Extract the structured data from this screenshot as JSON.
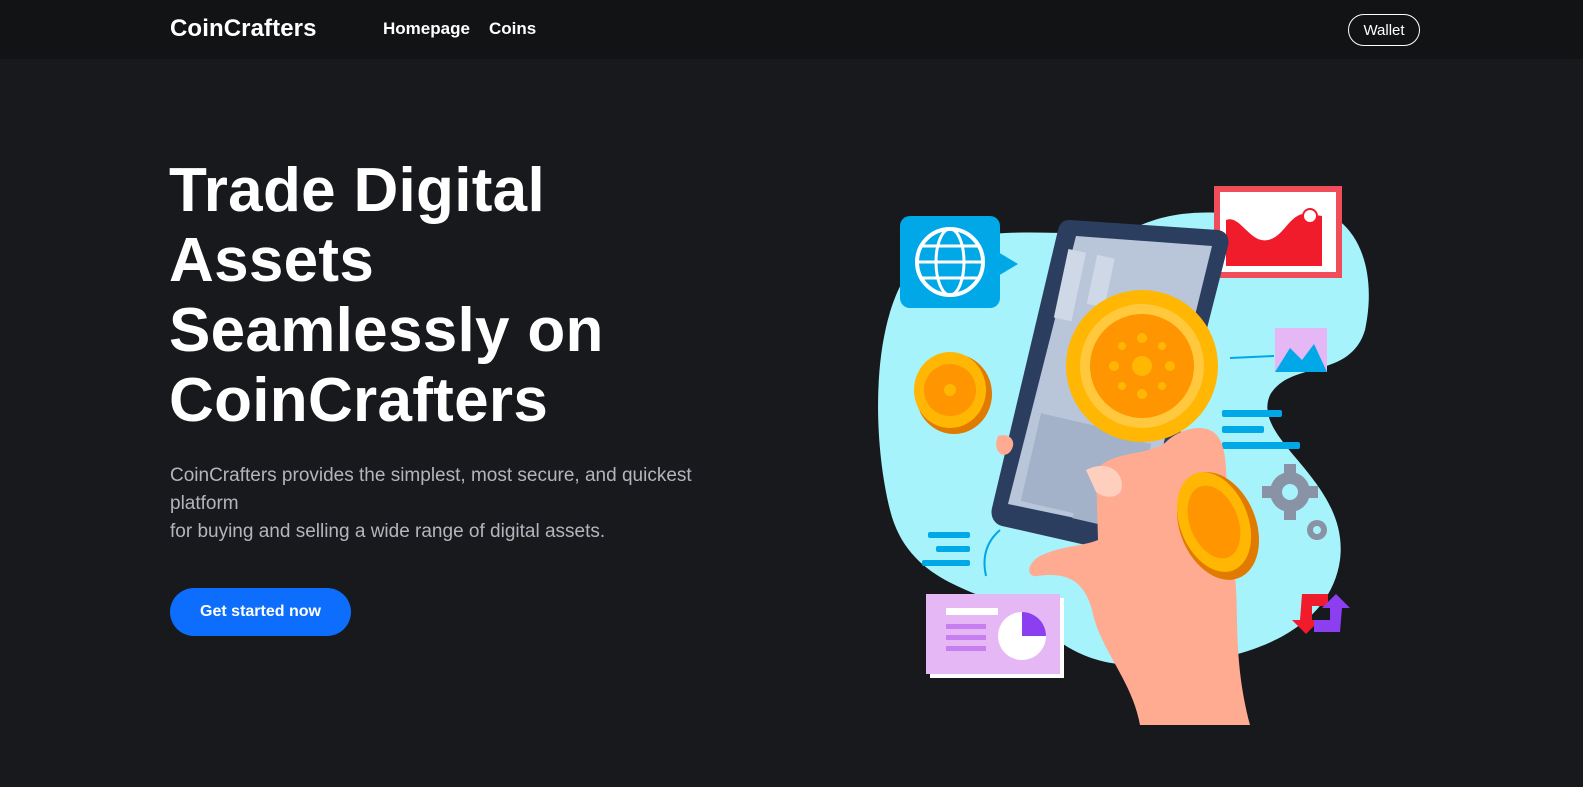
{
  "nav": {
    "brand": "CoinCrafters",
    "links": [
      {
        "label": "Homepage"
      },
      {
        "label": "Coins"
      }
    ],
    "wallet_label": "Wallet"
  },
  "hero": {
    "title_lines": [
      "Trade Digital",
      "Assets",
      "Seamlessly on",
      "CoinCrafters"
    ],
    "description_lines": [
      "CoinCrafters provides the simplest, most secure, and quickest",
      "platform",
      "for buying and selling a wide range of digital assets."
    ],
    "cta_label": "Get started now"
  },
  "illustration": {
    "subject": "hand-holding-phone-with-crypto-coins",
    "icons": [
      "globe-icon",
      "chart-card-icon",
      "image-icon",
      "gear-icon",
      "refresh-arrows-icon",
      "pie-chart-card-icon",
      "coin-icon"
    ]
  },
  "colors": {
    "background": "#18191d",
    "navbar": "#121315",
    "accent": "#0d6efd",
    "muted_text": "#b4b4be",
    "blob": "#a7f3fb",
    "coin": "#ffb703"
  }
}
